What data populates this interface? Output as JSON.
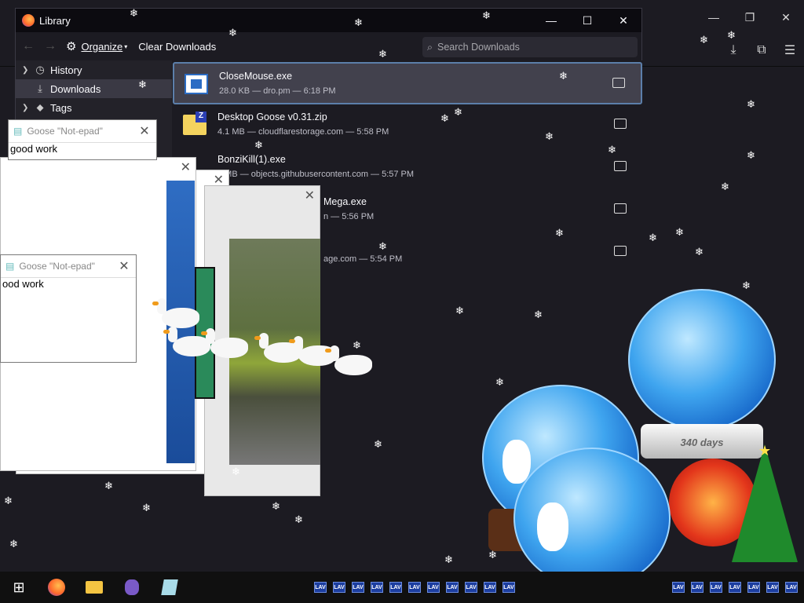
{
  "library": {
    "title": "Library",
    "toolbar": {
      "organize": "Organize",
      "clear_downloads": "Clear Downloads"
    },
    "search_placeholder": "Search Downloads",
    "sidebar": [
      {
        "label": "History"
      },
      {
        "label": "Downloads"
      },
      {
        "label": "Tags"
      }
    ],
    "downloads": [
      {
        "name": "CloseMouse.exe",
        "meta": "28.0 KB — dro.pm — 6:18 PM"
      },
      {
        "name": "Desktop Goose v0.31.zip",
        "meta": "4.1 MB — cloudflarestorage.com — 5:58 PM"
      },
      {
        "name": "BonziKill(1).exe",
        "meta": "8 MB — objects.githubusercontent.com — 5:57 PM"
      },
      {
        "name": "Mega.exe",
        "meta": "n — 5:56 PM"
      },
      {
        "name": "",
        "meta": "age.com — 5:54 PM"
      }
    ]
  },
  "notepads": [
    {
      "title": "Goose \"Not-epad\"",
      "text": "good work"
    },
    {
      "title": "Goose \"Not-epad\"",
      "text": "ood work"
    }
  ],
  "globes": {
    "label": "340 days"
  },
  "taskbar": {
    "lav_label": "LAV"
  }
}
